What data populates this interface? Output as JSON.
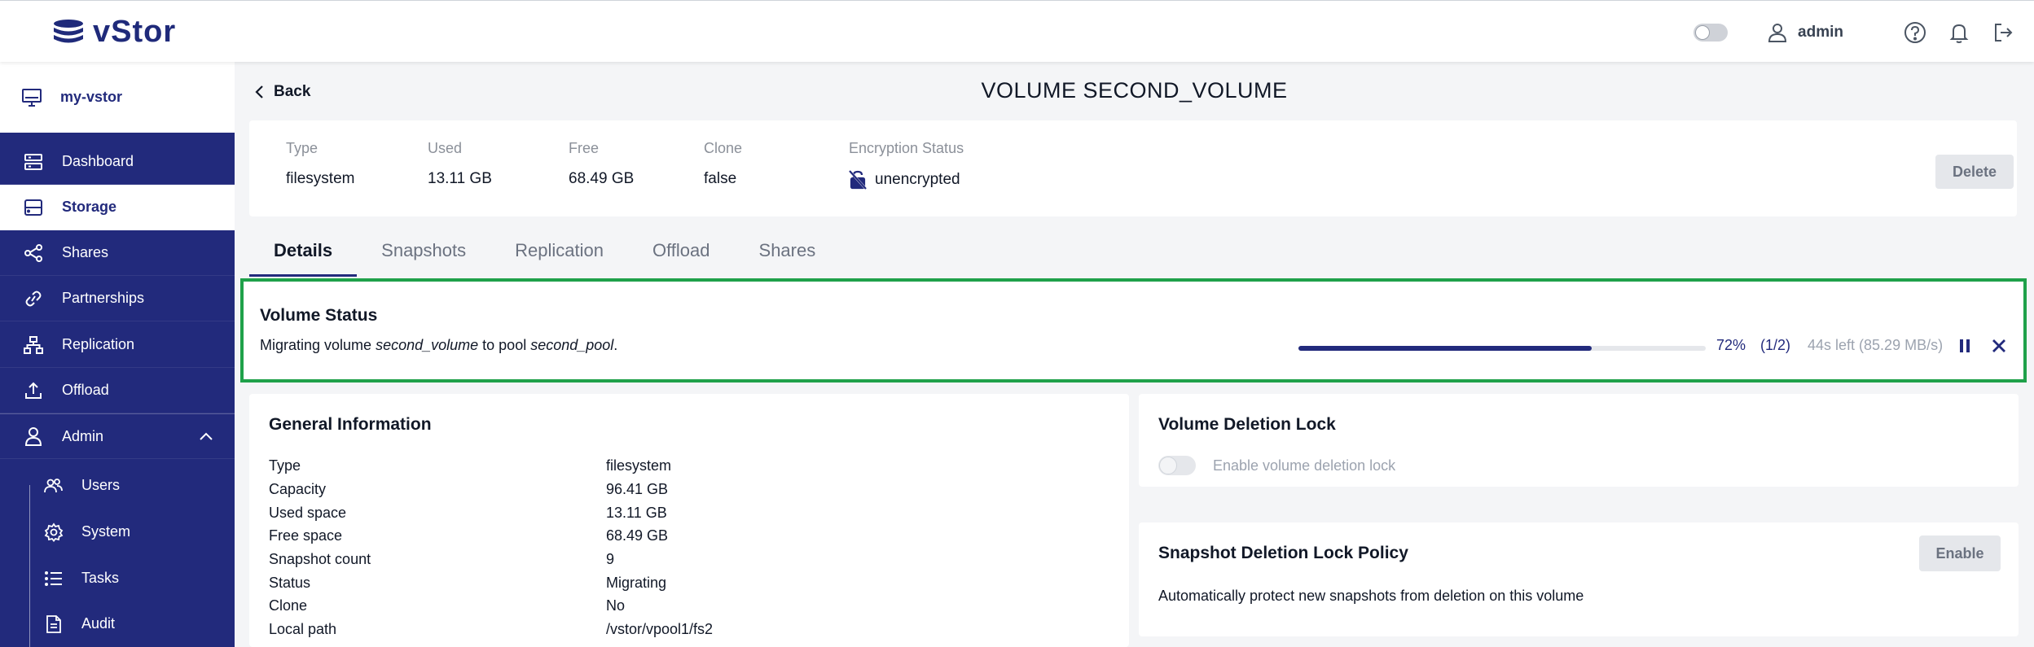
{
  "app": {
    "logo_text": "vStor"
  },
  "topbar": {
    "user_name": "admin"
  },
  "sidebar": {
    "device": "my-vstor",
    "items": [
      {
        "label": "Dashboard"
      },
      {
        "label": "Storage"
      },
      {
        "label": "Shares"
      },
      {
        "label": "Partnerships"
      },
      {
        "label": "Replication"
      },
      {
        "label": "Offload"
      },
      {
        "label": "Admin"
      }
    ],
    "admin_items": [
      {
        "label": "Users"
      },
      {
        "label": "System"
      },
      {
        "label": "Tasks"
      },
      {
        "label": "Audit"
      }
    ]
  },
  "header": {
    "back_label": "Back",
    "title": "VOLUME SECOND_VOLUME"
  },
  "summary": {
    "type_label": "Type",
    "type_value": "filesystem",
    "used_label": "Used",
    "used_value": "13.11 GB",
    "free_label": "Free",
    "free_value": "68.49 GB",
    "clone_label": "Clone",
    "clone_value": "false",
    "enc_label": "Encryption Status",
    "enc_value": "unencrypted",
    "delete_label": "Delete"
  },
  "tabs": [
    {
      "label": "Details"
    },
    {
      "label": "Snapshots"
    },
    {
      "label": "Replication"
    },
    {
      "label": "Offload"
    },
    {
      "label": "Shares"
    }
  ],
  "volume_status": {
    "title": "Volume Status",
    "msg_prefix": "Migrating volume ",
    "volume": "second_volume",
    "msg_mid": " to pool ",
    "pool": "second_pool",
    "msg_suffix": ".",
    "progress_percent": 72,
    "percent_label": "72%",
    "step_label": "(1/2)",
    "eta_label": "44s left (85.29 MB/s)"
  },
  "general_info": {
    "title": "General Information",
    "rows": [
      {
        "label": "Type",
        "value": "filesystem"
      },
      {
        "label": "Capacity",
        "value": "96.41 GB"
      },
      {
        "label": "Used space",
        "value": "13.11 GB"
      },
      {
        "label": "Free space",
        "value": "68.49 GB"
      },
      {
        "label": "Snapshot count",
        "value": "9"
      },
      {
        "label": "Status",
        "value": "Migrating"
      },
      {
        "label": "Clone",
        "value": "No"
      },
      {
        "label": "Local path",
        "value": "/vstor/vpool1/fs2"
      }
    ]
  },
  "deletion_lock": {
    "title": "Volume Deletion Lock",
    "toggle_label": "Enable volume deletion lock"
  },
  "snapshot_policy": {
    "title": "Snapshot Deletion Lock Policy",
    "description": "Automatically protect new snapshots from deletion on this volume",
    "enable_label": "Enable"
  },
  "colors": {
    "sidebar": "#222a7c",
    "accent": "#222a7c",
    "highlight": "#1fa14a"
  }
}
